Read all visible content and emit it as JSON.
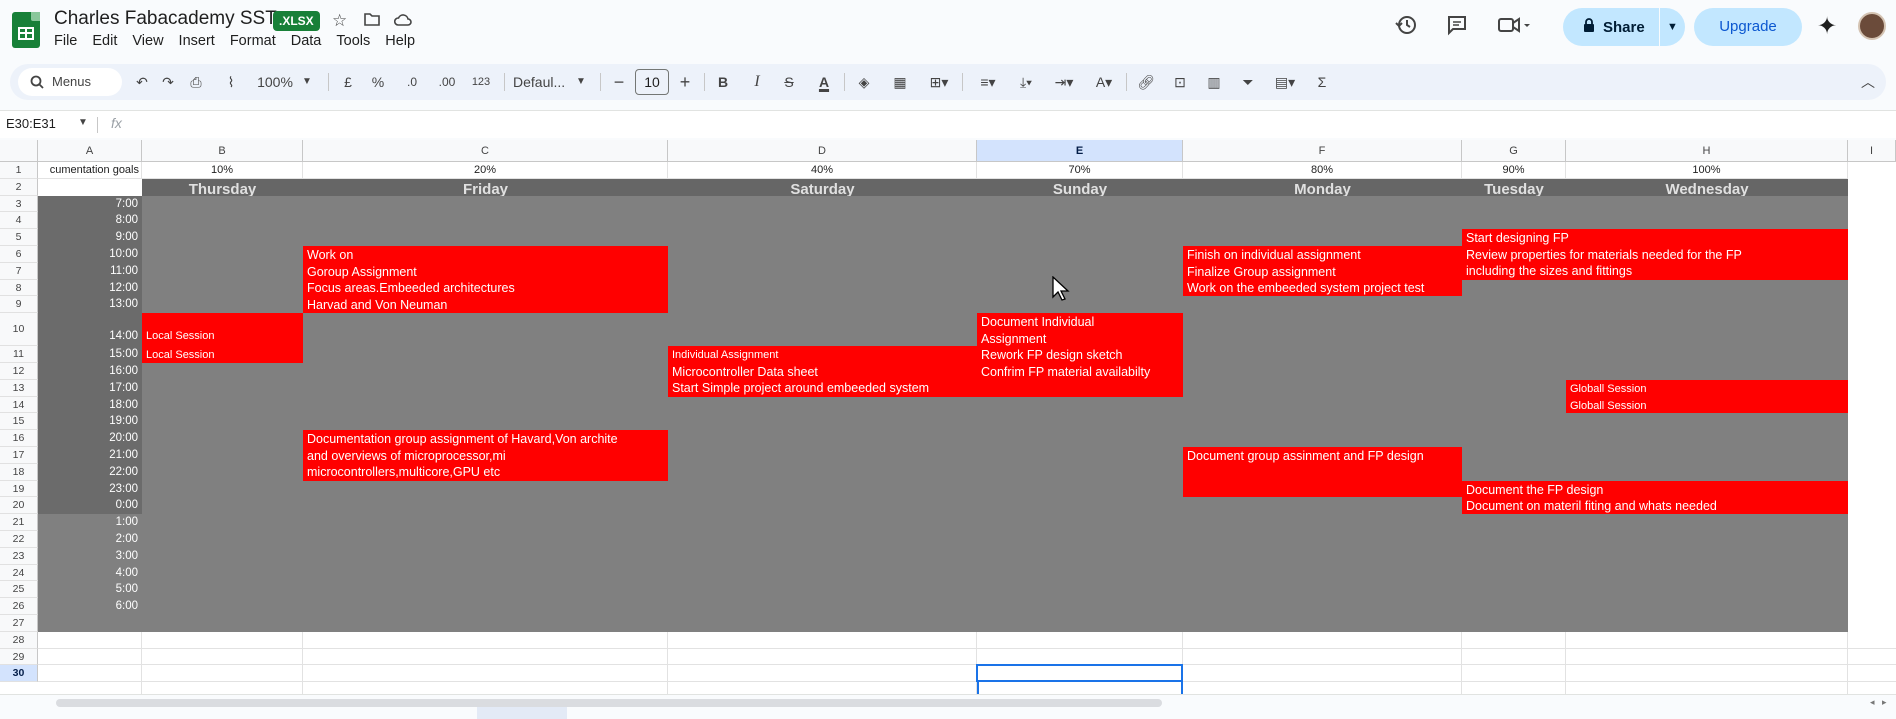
{
  "header": {
    "title": "Charles  Fabacademy SST",
    "badge": ".XLSX",
    "menu": [
      "File",
      "Edit",
      "View",
      "Insert",
      "Format",
      "Data",
      "Tools",
      "Help"
    ],
    "share_label": "Share",
    "upgrade_label": "Upgrade"
  },
  "toolbar": {
    "menus_label": "Menus",
    "zoom": "100%",
    "currency": "£",
    "percent": "%",
    "dec_decrease": ".0",
    "dec_increase": ".00",
    "number_format": "123",
    "font": "Defaul...",
    "font_size": "10",
    "bold": "B",
    "italic": "I",
    "strike": "S",
    "text_color": "A",
    "sum": "Σ"
  },
  "formula_bar": {
    "name_box": "E30:E31",
    "fx": "fx",
    "value": ""
  },
  "columns": [
    "A",
    "B",
    "C",
    "D",
    "E",
    "F",
    "G",
    "H",
    "I"
  ],
  "selected_column": "E",
  "selected_row": "30",
  "rows": [
    "1",
    "2",
    "3",
    "4",
    "5",
    "6",
    "7",
    "8",
    "9",
    "10",
    "11",
    "12",
    "13",
    "14",
    "15",
    "16",
    "17",
    "18",
    "19",
    "20",
    "21",
    "22",
    "23",
    "24",
    "25",
    "26",
    "27",
    "28",
    "29",
    "30"
  ],
  "row1": {
    "a": "cumentation goals",
    "b": "10%",
    "c": "20%",
    "d": "40%",
    "e": "70%",
    "f": "80%",
    "g": "90%",
    "h": "100%"
  },
  "days": [
    "Thursday",
    "Friday",
    "Saturday",
    "Sunday",
    "Monday",
    "Tuesday",
    "Wednesday"
  ],
  "times": [
    "7:00",
    "8:00",
    "9:00",
    "10:00",
    "11:00",
    "12:00",
    "13:00",
    "14:00",
    "15:00",
    "16:00",
    "17:00",
    "18:00",
    "19:00",
    "20:00",
    "21:00",
    "22:00",
    "23:00",
    "0:00",
    "1:00",
    "2:00",
    "3:00",
    "4:00",
    "5:00",
    "6:00"
  ],
  "events": {
    "thursday_1": "Local Session",
    "thursday_2": "Local Session",
    "friday_a": [
      "Work on",
      "Goroup Assignment",
      "Focus areas.Embeeded architectures",
      "Harvad and Von Neuman"
    ],
    "friday_b": [
      "Documentation group assignment of Havard,Von archite",
      "and overviews of microprocessor,mi",
      "microcontrollers,multicore,GPU etc"
    ],
    "saturday": [
      "Individual Assignment",
      "Microcontroller Data sheet",
      "Start Simple project around embeeded system"
    ],
    "sunday": [
      "Document Individual",
      "Assignment",
      "Rework FP design sketch",
      "Confrim FP material availabilty"
    ],
    "monday_a": [
      "Finish on individual assignment",
      "Finalize Group assignment",
      "Work on the embeeded system project test"
    ],
    "monday_b": "Document group assinment and FP design",
    "tuesday_a": [
      "Start designing FP",
      "Review properties for materials needed for the FP",
      "including the sizes and fittings"
    ],
    "tuesday_b": [
      "Document the FP design",
      "Document on materil fiting and whats needed"
    ],
    "wednesday_1": "Globall Session",
    "wednesday_2": "Globall Session"
  }
}
